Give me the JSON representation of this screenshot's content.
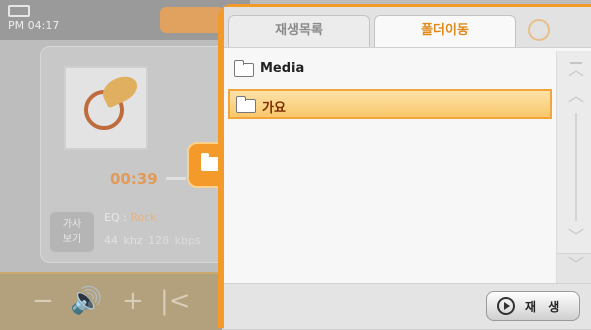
{
  "player": {
    "status_time": "PM 04:17",
    "elapsed": "00:39",
    "eq_label": "EQ :",
    "eq_value": "Rock",
    "side_option": [
      "가사",
      "보기"
    ],
    "sample_rate": "44 khz",
    "bitrate": "128 kbps",
    "controls": [
      "−",
      "🔊",
      "+",
      "|<"
    ]
  },
  "browser": {
    "tabs": [
      {
        "label": "재생목록",
        "active": false
      },
      {
        "label": "폴더이동",
        "active": true
      }
    ],
    "items": [
      {
        "label": "Media",
        "selected": false
      },
      {
        "label": "가요",
        "selected": true
      }
    ],
    "play_button": "재 생",
    "colors": {
      "accent": "#f39a2a",
      "selection": "#f9c86b",
      "active_tab_text": "#e08a1c"
    }
  }
}
